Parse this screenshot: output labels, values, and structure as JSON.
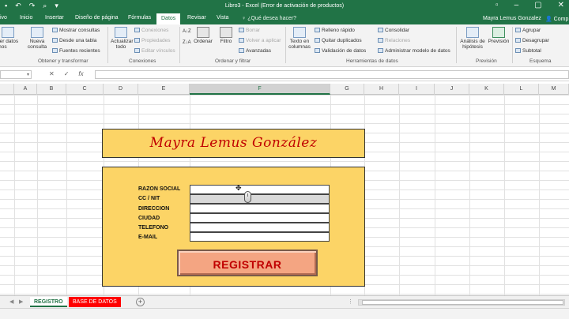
{
  "window": {
    "title": "Libro3 - Excel (Error de activación de productos)",
    "user": "Mayra Lemus Gonzalez",
    "share": "Comp"
  },
  "tabs": [
    {
      "label": "ivo"
    },
    {
      "label": "Inicio"
    },
    {
      "label": "Insertar"
    },
    {
      "label": "Diseño de página"
    },
    {
      "label": "Fórmulas"
    },
    {
      "label": "Datos"
    },
    {
      "label": "Revisar"
    },
    {
      "label": "Vista"
    }
  ],
  "tell_me": "¿Qué desea hacer?",
  "ribbon": {
    "get_external": "ner datos\nrnos",
    "new_query": "Nueva\nconsulta",
    "show_queries": "Mostrar consultas",
    "from_table": "Desde una tabla",
    "recent_sources": "Fuentes recientes",
    "refresh_all": "Actualizar\ntodo",
    "connections": "Conexiones",
    "properties": "Propiedades",
    "edit_links": "Editar vínculos",
    "sort": "Ordenar",
    "filter": "Filtro",
    "clear": "Borrar",
    "reapply": "Volver a aplicar",
    "advanced": "Avanzadas",
    "text_to_columns": "Texto en\ncolumnas",
    "flash_fill": "Relleno rápido",
    "remove_duplicates": "Quitar duplicados",
    "data_validation": "Validación de datos",
    "consolidate": "Consolidar",
    "relationships": "Relaciones",
    "data_model": "Administrar modelo de datos",
    "what_if": "Análisis de\nhipótesis",
    "forecast": "Previsión",
    "group": "Agrupar",
    "ungroup": "Desagrupar",
    "subtotal": "Subtotal",
    "groups": {
      "get_transform": "Obtener y transformar",
      "connections": "Conexiones",
      "sort_filter": "Ordenar y filtrar",
      "data_tools": "Herramientas de datos",
      "forecast": "Previsión",
      "outline": "Esquema"
    }
  },
  "formula_bar": {
    "fx": "fx"
  },
  "columns": [
    "A",
    "B",
    "C",
    "D",
    "E",
    "F",
    "G",
    "H",
    "I",
    "J",
    "K",
    "L",
    "M"
  ],
  "selected_column": "F",
  "form": {
    "title": "Mayra Lemus González",
    "labels": [
      "RAZON SOCIAL",
      "CC / NIT",
      "DIRECCION",
      "CIUDAD",
      "TELEFONO",
      "E-MAIL"
    ],
    "register_button": "REGISTRAR"
  },
  "sheets": {
    "active": "REGISTRO",
    "other": "BASE DE DATOS"
  },
  "colors": {
    "excel_green": "#217346",
    "card_yellow": "#FCD466",
    "title_red": "#C00000",
    "button_salmon": "#F4A582",
    "sheet_red": "#FF0000"
  }
}
